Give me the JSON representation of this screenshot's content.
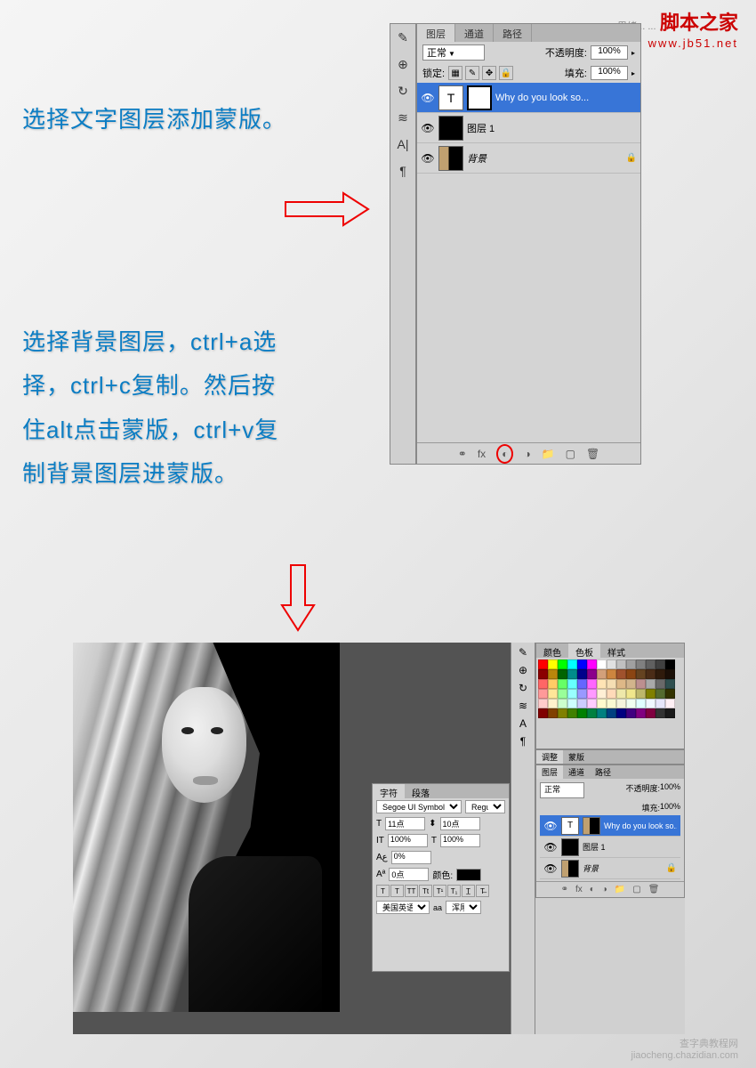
{
  "watermark": {
    "title": "脚本之家",
    "subtitle": "思绪... ...",
    "url": "www.jb51.net",
    "bottom_site": "查字典教程网",
    "bottom_url": "jiaocheng.chazidian.com"
  },
  "instructions": {
    "step1": "选择文字图层添加蒙版。",
    "step2": "选择背景图层，ctrl+a选择，ctrl+c复制。然后按住alt点击蒙版，ctrl+v复制背景图层进蒙版。"
  },
  "panel": {
    "tabs": {
      "layers": "图层",
      "channels": "通道",
      "paths": "路径"
    },
    "blend_mode": "正常",
    "opacity_label": "不透明度:",
    "opacity_value": "100%",
    "lock_label": "锁定:",
    "fill_label": "填充:",
    "fill_value": "100%",
    "layers": [
      {
        "name": "Why do you look so...",
        "type": "text"
      },
      {
        "name": "图层 1"
      },
      {
        "name": "背景"
      }
    ]
  },
  "char_panel": {
    "tab1": "字符",
    "tab2": "段落",
    "font": "Segoe UI Symbol",
    "style": "Regular",
    "size": "11点",
    "leading": "10点",
    "tracking_v": "100%",
    "tracking_h": "100%",
    "scale": "0%",
    "color_label": "颜色:",
    "baseline": "0点",
    "lang": "美国英语",
    "aa": "浑厚"
  },
  "right_dock": {
    "swatches_tab1": "颜色",
    "swatches_tab2": "色板",
    "swatches_tab3": "样式",
    "adjust_tab1": "调整",
    "adjust_tab2": "蒙版",
    "layers_tab1": "图层",
    "layers_tab2": "通道",
    "layers_tab3": "路径",
    "blend_mode": "正常",
    "opacity_label": "不透明度:",
    "opacity_value": "100%",
    "fill_label": "填充:",
    "fill_value": "100%",
    "layers": [
      {
        "name": "Why do you look so..."
      },
      {
        "name": "图层 1"
      },
      {
        "name": "背景"
      }
    ]
  },
  "swatch_colors": [
    "#ff0000",
    "#ffff00",
    "#00ff00",
    "#00ffff",
    "#0000ff",
    "#ff00ff",
    "#ffffff",
    "#e0e0e0",
    "#c0c0c0",
    "#a0a0a0",
    "#808080",
    "#606060",
    "#404040",
    "#000000",
    "#8b0000",
    "#b8860b",
    "#006400",
    "#008b8b",
    "#00008b",
    "#8b008b",
    "#d3a07a",
    "#cd853f",
    "#a0522d",
    "#8b4513",
    "#654321",
    "#4a2c17",
    "#2f1b0c",
    "#1a0f07",
    "#ff6666",
    "#ffcc66",
    "#66ff66",
    "#66ffff",
    "#6666ff",
    "#ff66ff",
    "#ffe4b5",
    "#f5deb3",
    "#deb887",
    "#d2b48c",
    "#bc8f8f",
    "#a9a9a9",
    "#696969",
    "#2f4f4f",
    "#ff9999",
    "#ffe699",
    "#99ff99",
    "#99ffff",
    "#9999ff",
    "#ff99ff",
    "#ffefd5",
    "#ffdab9",
    "#eee8aa",
    "#f0e68c",
    "#bdb76b",
    "#808000",
    "#556b2f",
    "#333300",
    "#ffcccc",
    "#fff2cc",
    "#ccffcc",
    "#ccffff",
    "#ccccff",
    "#ffccff",
    "#fffacd",
    "#fafad2",
    "#f5f5dc",
    "#f0fff0",
    "#e0ffff",
    "#f0f8ff",
    "#e6e6fa",
    "#fff0f5",
    "#800000",
    "#804000",
    "#808000",
    "#408000",
    "#008000",
    "#008040",
    "#008080",
    "#004080",
    "#000080",
    "#400080",
    "#800080",
    "#800040",
    "#333333",
    "#1a1a1a"
  ]
}
